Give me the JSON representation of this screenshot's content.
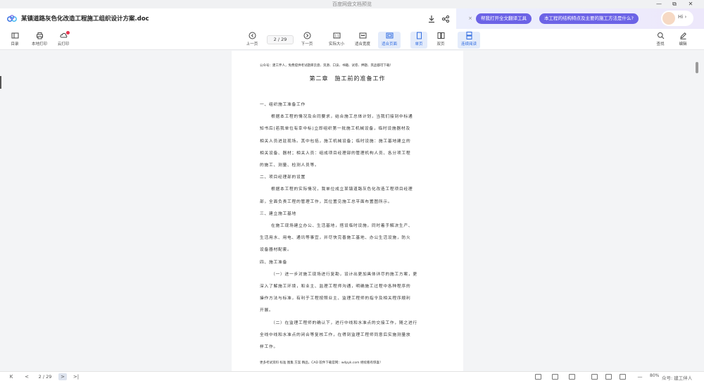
{
  "window": {
    "title": "百度网盘文档预览",
    "minimize": "—",
    "restore": "⧉",
    "close": "✕"
  },
  "doc_header": {
    "title": "某镇道路灰色化改造工程施工组织设计方案.doc",
    "download_icon": "download-icon",
    "share_icon": "share-icon"
  },
  "ai": {
    "close": "×",
    "chips": [
      "帮我打开全文翻译工具",
      "本工程的结构特点及主要的施工方法是什么?"
    ],
    "greeting": "Hi",
    "greeting_arrow": "›"
  },
  "toolbar": {
    "left": [
      {
        "label": "目录",
        "icon": "toc-icon"
      },
      {
        "label": "本地打印",
        "icon": "printer-icon"
      },
      {
        "label": "云打印",
        "icon": "cloud-print-icon"
      }
    ],
    "prev_page": "上一页",
    "page_indicator": "2 / 29",
    "next_page": "下一页",
    "view_modes": [
      {
        "label": "实际大小",
        "icon": "actual-size-icon"
      },
      {
        "label": "适合宽度",
        "icon": "fit-width-icon"
      },
      {
        "label": "适合页面",
        "icon": "fit-page-icon",
        "active": true
      },
      {
        "label": "单页",
        "icon": "single-page-icon",
        "active": true
      },
      {
        "label": "双页",
        "icon": "double-page-icon"
      },
      {
        "label": "连续阅读",
        "icon": "continuous-icon",
        "active": true
      }
    ],
    "right": [
      {
        "label": "查找",
        "icon": "search-icon"
      },
      {
        "label": "编辑",
        "icon": "edit-icon"
      }
    ]
  },
  "page": {
    "top_note": "公众号：建工伴人，免费提供考试题库云盘、资源、口诀、书籍、试卷、押题、宾品都可下载！",
    "chapter_title": "第二章　施工前的准备工作",
    "lines": [
      {
        "text": "一、组织施工准备工作",
        "indent": false
      },
      {
        "text": "根据本工程的情况及合同要求，结合施工总体计划，当我们接到中标通",
        "indent": true
      },
      {
        "text": "知书后(若我单位有幸中标)立即组织第一批施工机械设备，临时设施器材及",
        "indent": false
      },
      {
        "text": "相关人员进驻现场。其中包括，施工机械设备；临时设施：施工基地建立的",
        "indent": false
      },
      {
        "text": "相关设备、器材；相关人员：组成项目经理部的管理机构人员、各分项工程",
        "indent": false
      },
      {
        "text": "的施工、测量、检测人员等。",
        "indent": false
      },
      {
        "text": "二、项目经理部的设置",
        "indent": false
      },
      {
        "text": "根据本工程的实际情况，我单位成立某镇道路灰色化改造工程项目经理",
        "indent": true
      },
      {
        "text": "部，全面负责工程的管理工作，其位置见施工总平面布置图所示。",
        "indent": false
      },
      {
        "text": "三、建立施工基地",
        "indent": false
      },
      {
        "text": "在施工现场建立办公、生活基地，搭设临时设施，同时着手解决生产、",
        "indent": true
      },
      {
        "text": "生活用水、用电、通讯等事宜，并尽快完善施工基地、办公生活设施，防火",
        "indent": false
      },
      {
        "text": "设备器材配套。",
        "indent": false
      },
      {
        "text": "四、施工准备",
        "indent": false
      },
      {
        "text": "（一）进一步对施工现场进行复勘，设计出更加具体详尽的施工方案，更",
        "indent": true
      },
      {
        "text": "深入了解施工环境，和业主、监理工程师沟通，明确施工过程中各种程序的",
        "indent": false
      },
      {
        "text": "操作方法与标准，有利于工程按照业主、监理工程师的指令及相关程序顺利",
        "indent": false
      },
      {
        "text": "开展。",
        "indent": false
      },
      {
        "text": "（二）在监理工程师的确认下，进行中线和水准点的交接工作，随之进行",
        "indent": true
      },
      {
        "text": "全线中线和水准点的闭合等复核工作，在得到监理工程师同意后实施测量放",
        "indent": false
      },
      {
        "text": "样工作。",
        "indent": false
      }
    ],
    "footer_note": "更多考试资料 标准 图集 方案 精品，CAD 软件下载官网：wdpyk.com 继续看有惊喜！"
  },
  "statusbar": {
    "first": "K",
    "prev": "<",
    "page_indicator": "2 / 29",
    "next": ">",
    "last": ">|",
    "zoom_out": "—",
    "zoom": "80%",
    "watermark": "众号: 建工伴人"
  }
}
